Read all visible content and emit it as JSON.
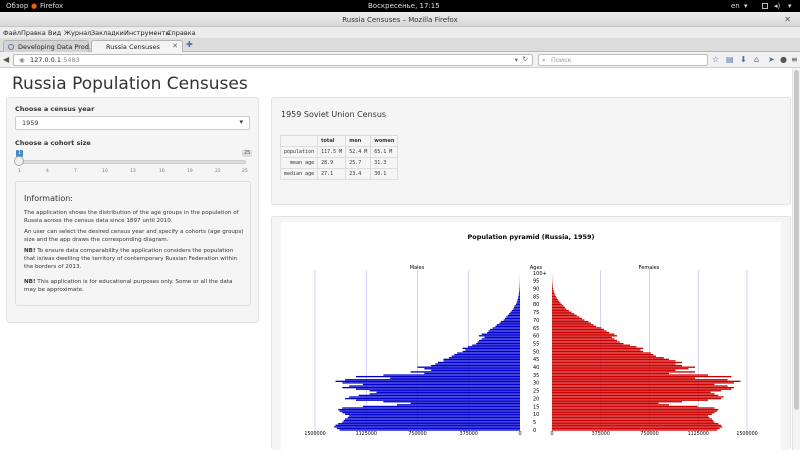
{
  "system": {
    "activities": "Обзор",
    "app_name": "Firefox",
    "clock": "Воскресенье, 17:15",
    "keyboard_layout": "en"
  },
  "window": {
    "title": "Russia Censuses – Mozilla Firefox"
  },
  "menu": [
    "Файл",
    "Правка",
    "Вид",
    "Журнал",
    "Закладки",
    "Инструменты",
    "Справка"
  ],
  "tabs": [
    {
      "label": "Developing Data Prod...",
      "active": false
    },
    {
      "label": "Russia Censuses",
      "active": true
    }
  ],
  "nav": {
    "url_host": "127.0.0.1",
    "url_port": ":5483",
    "search_placeholder": "Поиск"
  },
  "page": {
    "title": "Russia Population Censuses"
  },
  "sidebar": {
    "year_label": "Choose a census year",
    "year_value": "1959",
    "cohort_label": "Choose a cohort size",
    "cohort_value": "1",
    "cohort_min": "1",
    "cohort_max": "25",
    "cohort_ticks": [
      "1",
      "4",
      "7",
      "10",
      "13",
      "16",
      "19",
      "22",
      "25"
    ],
    "info_title": "Information:",
    "info_p1": "The application shows the distribution of the age groups in the population of Russia across the census data since 1897 until 2010.",
    "info_p2": "An user can select the desired census year and specify a cohorts (age groups) size and the app draws the corresponding diagram.",
    "info_p3_bold": "NB!",
    "info_p3": " To ensure data comparability the application considers the population that is/was dwelling the territory of contemporary Russian Federation within the borders of 2013.",
    "info_p4_bold": "NB!",
    "info_p4": " This application is for educational purposes only. Some or all the data may be approximate."
  },
  "census": {
    "title": "1959 Soviet Union Census",
    "headers": [
      "",
      "total",
      "men",
      "women"
    ],
    "rows": [
      [
        "population",
        "117.5 M",
        "52.4 M",
        "65.1 M"
      ],
      [
        "mean age",
        "28.9",
        "25.7",
        "31.3"
      ],
      [
        "median age",
        "27.1",
        "23.4",
        "30.1"
      ]
    ]
  },
  "chart_data": {
    "type": "bar",
    "title": "Population pyramid (Russia, 1959)",
    "left_label": "Males",
    "right_label": "Females",
    "center_label": "Ages",
    "age_labels": [
      "100+",
      "95",
      "90",
      "85",
      "80",
      "75",
      "70",
      "65",
      "60",
      "55",
      "50",
      "45",
      "40",
      "35",
      "30",
      "25",
      "20",
      "15",
      "10",
      "5",
      "0"
    ],
    "x_ticks_left": [
      "1500000",
      "1125000",
      "750000",
      "375000",
      "0"
    ],
    "x_ticks_right": [
      "0",
      "375000",
      "750000",
      "1125000",
      "1500000"
    ],
    "xlim": [
      0,
      1500000
    ],
    "colors": {
      "male": "#0000cc",
      "female": "#cc0000",
      "grid": "#b0b0ff"
    },
    "ages": [
      0,
      1,
      2,
      3,
      4,
      5,
      6,
      7,
      8,
      9,
      10,
      11,
      12,
      13,
      14,
      15,
      16,
      17,
      18,
      19,
      20,
      21,
      22,
      23,
      24,
      25,
      26,
      27,
      28,
      29,
      30,
      31,
      32,
      33,
      34,
      35,
      36,
      37,
      38,
      39,
      40,
      41,
      42,
      43,
      44,
      45,
      46,
      47,
      48,
      49,
      50,
      51,
      52,
      53,
      54,
      55,
      56,
      57,
      58,
      59,
      60,
      61,
      62,
      63,
      64,
      65,
      66,
      67,
      68,
      69,
      70,
      71,
      72,
      73,
      74,
      75,
      76,
      77,
      78,
      79,
      80,
      81,
      82,
      83,
      84,
      85,
      86,
      87,
      88,
      89,
      90,
      91,
      92,
      93,
      94,
      95,
      96,
      97,
      98,
      99,
      100
    ],
    "male": [
      1320000,
      1340000,
      1360000,
      1350000,
      1330000,
      1300000,
      1290000,
      1280000,
      1260000,
      1250000,
      1280000,
      1300000,
      1320000,
      1330000,
      1300000,
      1150000,
      900000,
      800000,
      1000000,
      1200000,
      1280000,
      1250000,
      1180000,
      1100000,
      1050000,
      1100000,
      1200000,
      1300000,
      1250000,
      1150000,
      1300000,
      1350000,
      1280000,
      950000,
      1200000,
      1000000,
      700000,
      800000,
      650000,
      700000,
      750000,
      650000,
      620000,
      600000,
      560000,
      560000,
      520000,
      500000,
      480000,
      460000,
      420000,
      400000,
      420000,
      380000,
      350000,
      320000,
      310000,
      300000,
      280000,
      260000,
      300000,
      280000,
      240000,
      230000,
      220000,
      200000,
      180000,
      170000,
      150000,
      140000,
      120000,
      110000,
      100000,
      90000,
      80000,
      70000,
      60000,
      50000,
      45000,
      40000,
      30000,
      25000,
      20000,
      18000,
      15000,
      12000,
      10000,
      8000,
      6000,
      5000,
      4000,
      3000,
      2500,
      2000,
      1500,
      1000,
      800,
      600,
      400,
      300,
      200
    ],
    "female": [
      1270000,
      1290000,
      1310000,
      1300000,
      1280000,
      1250000,
      1240000,
      1230000,
      1210000,
      1200000,
      1230000,
      1250000,
      1270000,
      1280000,
      1250000,
      1120000,
      900000,
      820000,
      1000000,
      1200000,
      1300000,
      1320000,
      1280000,
      1250000,
      1220000,
      1300000,
      1380000,
      1400000,
      1350000,
      1250000,
      1400000,
      1450000,
      1350000,
      1100000,
      1380000,
      1200000,
      900000,
      1100000,
      950000,
      1050000,
      1100000,
      1000000,
      950000,
      1000000,
      950000,
      900000,
      860000,
      800000,
      780000,
      760000,
      700000,
      680000,
      700000,
      650000,
      600000,
      550000,
      520000,
      500000,
      480000,
      460000,
      500000,
      480000,
      440000,
      420000,
      400000,
      380000,
      340000,
      320000,
      300000,
      280000,
      250000,
      230000,
      210000,
      190000,
      170000,
      150000,
      130000,
      110000,
      100000,
      90000,
      75000,
      65000,
      55000,
      45000,
      38000,
      30000,
      24000,
      19000,
      15000,
      12000,
      9000,
      7000,
      5500,
      4000,
      3000,
      2000,
      1500,
      1000,
      700,
      500,
      300
    ]
  }
}
